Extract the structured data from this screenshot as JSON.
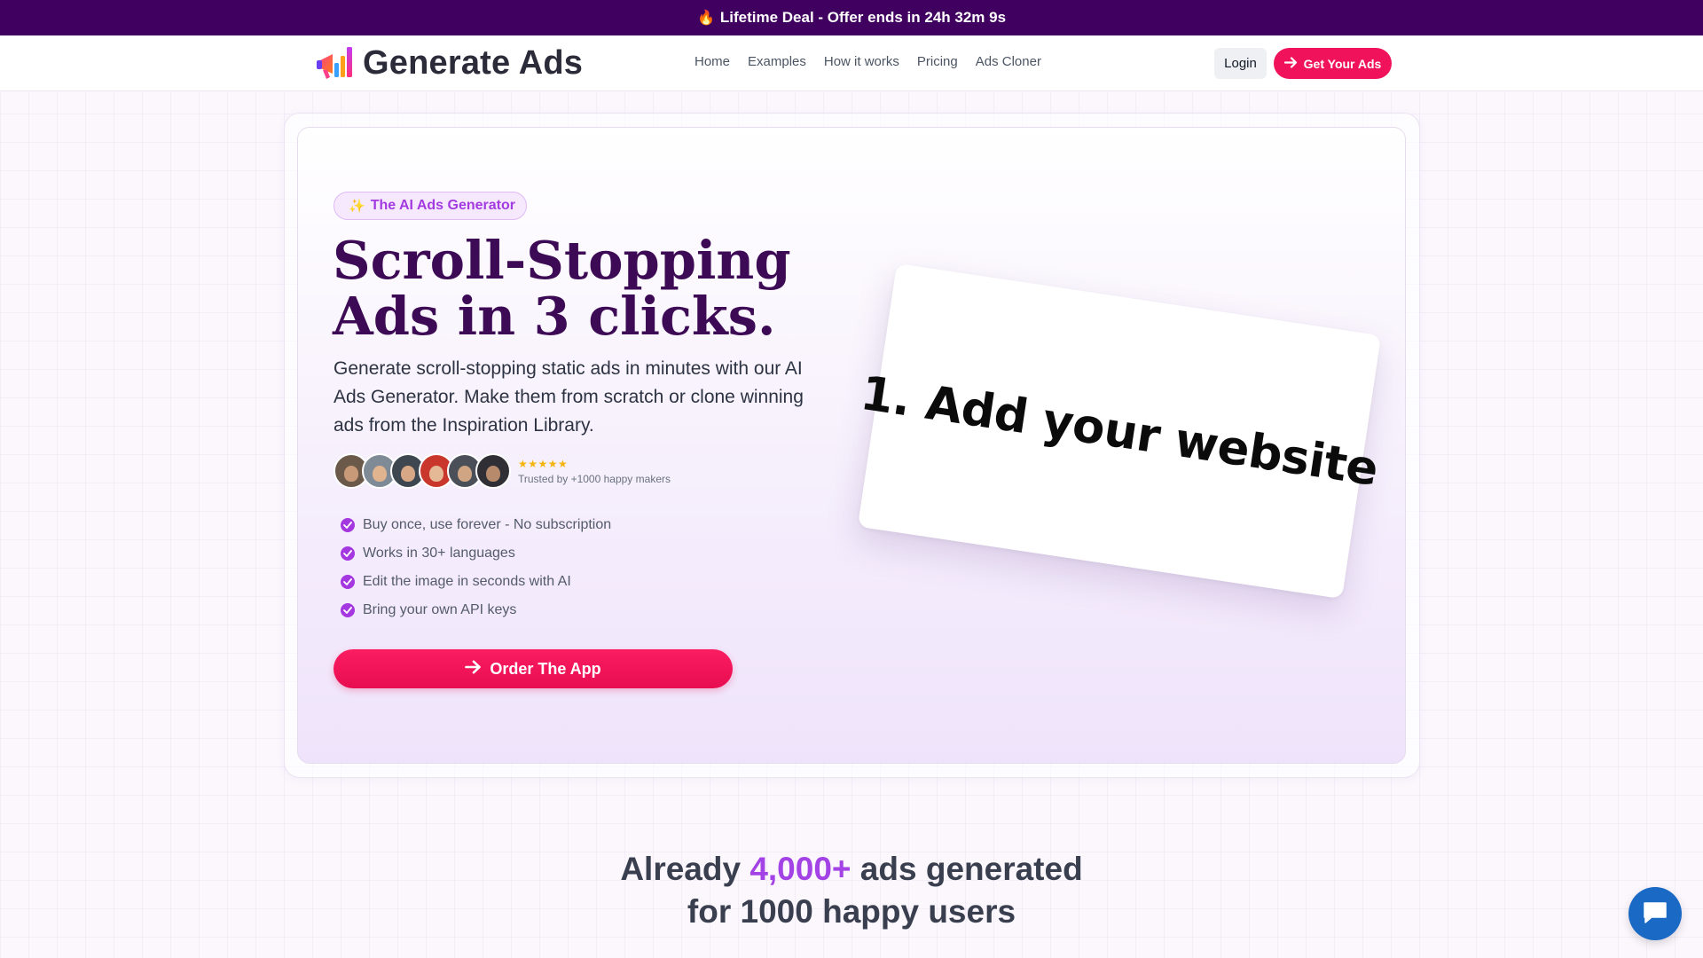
{
  "announcement": {
    "icon": "flame-icon",
    "text": "Lifetime Deal - Offer ends in 24h 32m 9s"
  },
  "navbar": {
    "brand": "Generate Ads",
    "links": [
      "Home",
      "Examples",
      "How it works",
      "Pricing",
      "Ads Cloner"
    ],
    "login_label": "Login",
    "cta_label": "Get Your Ads"
  },
  "hero": {
    "badge": "The AI Ads Generator",
    "headline_line1": "Scroll-Stopping",
    "headline_line2": "Ads in 3 clicks.",
    "subtext": "Generate scroll-stopping static ads in minutes with our AI Ads Generator. Make them from scratch or clone winning ads from the Inspiration Library.",
    "rating_stars": "★★★★★",
    "trusted_text": "Trusted by +1000 happy makers",
    "features": [
      "Buy once, use forever - No subscription",
      "Works in 30+ languages",
      "Edit the image in seconds with AI",
      "Bring your own API keys"
    ],
    "order_label": "Order The App",
    "ad_card_text": "1. Add your website"
  },
  "stats": {
    "prefix": "Already ",
    "highlight": "4,000+",
    "suffix": " ads generated",
    "line2": "for 1000 happy users"
  },
  "colors": {
    "announcement_bg": "#40005f",
    "accent_pink": "#f0125a",
    "accent_purple": "#a342e5",
    "headline": "#3d0a55",
    "chat_blue": "#1a69c4"
  }
}
